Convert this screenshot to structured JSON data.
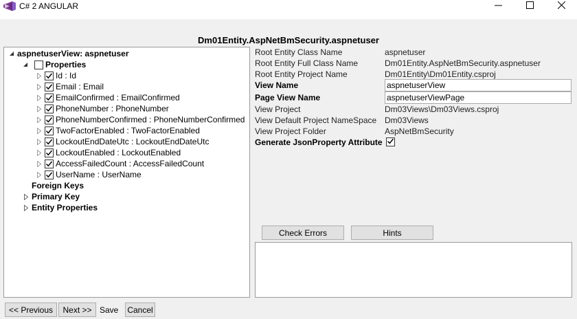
{
  "window": {
    "title": "C# 2 ANGULAR",
    "minimize_icon": "minimize-icon",
    "maximize_icon": "maximize-icon",
    "close_icon": "close-icon"
  },
  "header": {
    "title": "Dm01Entity.AspNetBmSecurity.aspnetuser"
  },
  "tree": {
    "root_label": "aspnetuserView: aspnetuser",
    "properties_label": "Properties",
    "properties_checked": false,
    "property_items": [
      {
        "label": "Id : Id",
        "checked": true
      },
      {
        "label": "Email : Email",
        "checked": true
      },
      {
        "label": "EmailConfirmed : EmailConfirmed",
        "checked": true
      },
      {
        "label": "PhoneNumber : PhoneNumber",
        "checked": true
      },
      {
        "label": "PhoneNumberConfirmed : PhoneNumberConfirmed",
        "checked": true
      },
      {
        "label": "TwoFactorEnabled : TwoFactorEnabled",
        "checked": true
      },
      {
        "label": "LockoutEndDateUtc : LockoutEndDateUtc",
        "checked": true
      },
      {
        "label": "LockoutEnabled : LockoutEnabled",
        "checked": true
      },
      {
        "label": "AccessFailedCount : AccessFailedCount",
        "checked": true
      },
      {
        "label": "UserName : UserName",
        "checked": true
      }
    ],
    "foreign_keys_label": "Foreign Keys",
    "primary_key_label": "Primary Key",
    "entity_properties_label": "Entity Properties"
  },
  "info": {
    "root_entity_class_name_label": "Root Entity Class Name",
    "root_entity_class_name_value": "aspnetuser",
    "root_entity_full_class_name_label": "Root Entity Full Class Name",
    "root_entity_full_class_name_value": "Dm01Entity.AspNetBmSecurity.aspnetuser",
    "root_entity_project_name_label": "Root Entity Project Name",
    "root_entity_project_name_value": "Dm01Entity\\Dm01Entity.csproj",
    "view_name_label": "View Name",
    "view_name_value": "aspnetuserView",
    "page_view_name_label": "Page View Name",
    "page_view_name_value": "aspnetuserViewPage",
    "view_project_label": "View Project",
    "view_project_value": "Dm03Views\\Dm03Views.csproj",
    "view_default_namespace_label": "View Default Project NameSpace",
    "view_default_namespace_value": "Dm03Views",
    "view_project_folder_label": "View Project Folder",
    "view_project_folder_value": "AspNetBmSecurity",
    "generate_json_label": "Generate JsonProperty Attribute",
    "generate_json_checked": true
  },
  "actions": {
    "check_errors_label": "Check Errors",
    "hints_label": "Hints"
  },
  "footer": {
    "previous_label": "<< Previous",
    "next_label": "Next >>",
    "save_label": "Save",
    "cancel_label": "Cancel"
  },
  "colors": {
    "accent_vs_purple": "#68217a",
    "background": "#f0f0f0",
    "button_face": "#e1e1e1"
  }
}
